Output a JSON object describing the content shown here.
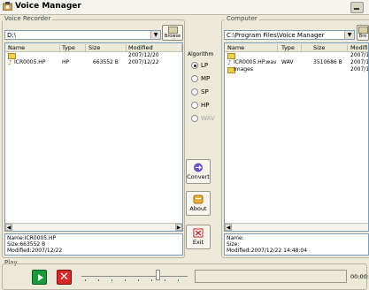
{
  "window": {
    "title": "Voice Manager"
  },
  "recorder": {
    "group_label": "Voice Recorder",
    "path": "D:\\",
    "browse_label": "Browse",
    "columns": [
      "Name",
      "Type",
      "Size",
      "Modified"
    ],
    "rows": [
      {
        "name": "",
        "type": "",
        "size": "",
        "modified": "2007/12/20",
        "icon": "folder-icon"
      },
      {
        "name": "ICR0005.HP",
        "type": "HP",
        "size": "663552 B",
        "modified": "2007/12/22",
        "icon": "audio-file-icon"
      }
    ],
    "info": [
      "Name:ICR0005.HP",
      "Size:663552 B",
      "Modified:2007/12/22"
    ]
  },
  "algorithm": {
    "label": "Algorithm",
    "options": [
      {
        "label": "LP",
        "selected": true,
        "enabled": true
      },
      {
        "label": "MP",
        "selected": false,
        "enabled": true
      },
      {
        "label": "SP",
        "selected": false,
        "enabled": true
      },
      {
        "label": "HP",
        "selected": false,
        "enabled": true
      },
      {
        "label": "WAV",
        "selected": false,
        "enabled": false
      }
    ]
  },
  "actions": {
    "convert": "Convert",
    "about": "About",
    "exit": "Exit"
  },
  "computer": {
    "group_label": "Computer",
    "path": "C:\\Program Files\\Voice Manager",
    "browse_label": "Bro",
    "columns": [
      "Name",
      "Type",
      "Size",
      "Modified"
    ],
    "rows": [
      {
        "name": "",
        "type": "",
        "size": "",
        "modified": "2007/1",
        "icon": "folder-icon"
      },
      {
        "name": "ICR0005.HP.wav",
        "type": "WAV",
        "size": "3510686 B",
        "modified": "2007/1",
        "icon": "audio-file-icon"
      },
      {
        "name": "Images",
        "type": "",
        "size": "",
        "modified": "2007/1",
        "icon": "folder-icon"
      }
    ],
    "info": [
      "Name:",
      "Size:",
      "Modified:2007/12/22 14:48:04"
    ]
  },
  "play": {
    "label": "Play",
    "time": "00:00:0",
    "position": 0.7
  }
}
